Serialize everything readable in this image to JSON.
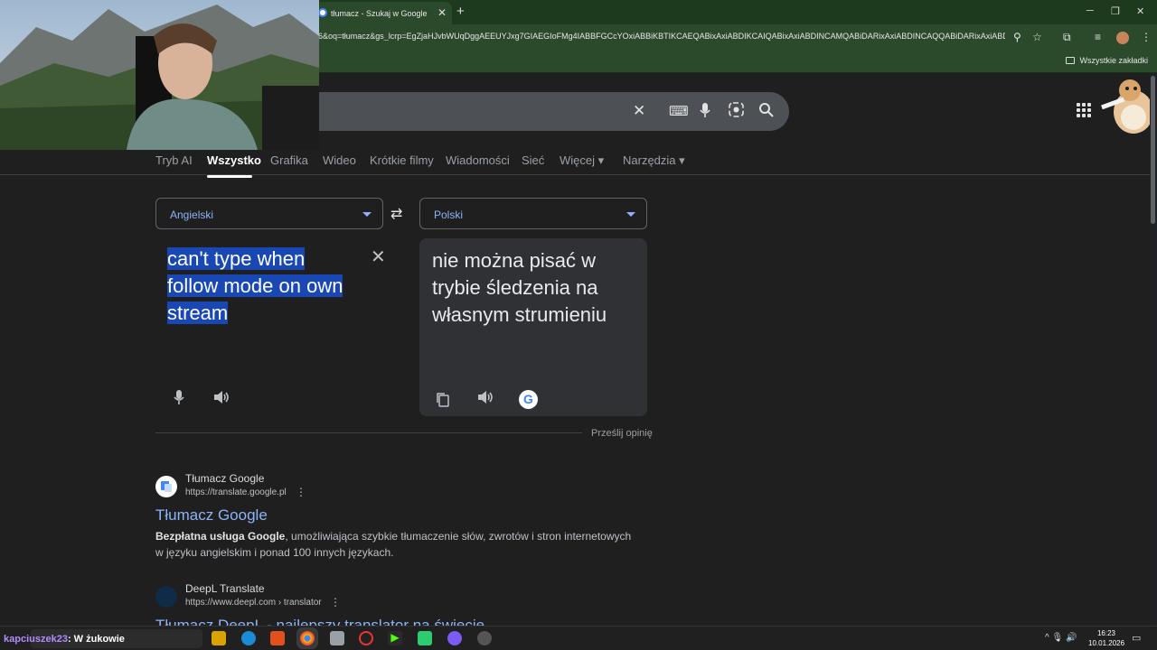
{
  "browser": {
    "tab_title": "tłumacz - Szukaj w Google",
    "tab_close": "✕",
    "new_tab": "+",
    "url": "6&oq=tłumacz&gs_lcrp=EgZjaHJvbWUqDggAEEUYJxg7GIAEGIoFMg4IABBFGCcYOxiABBiKBTIKCAEQABixAxiABDIKCAIQABixAxiABDINCAMQABiDARixAxiABDINCAQQABiDARixAxiABDI...",
    "bookmarks_all": "Wszystkie zakładki",
    "window_controls": {
      "minimize": "─",
      "restore": "❐",
      "close": "✕"
    }
  },
  "search": {
    "clear": "✕",
    "keyboard_icon": "⌨",
    "mic_icon": "🎤",
    "lens_icon": "⊙",
    "search_icon": "⚲"
  },
  "tabs": [
    {
      "label": "Tryb AI"
    },
    {
      "label": "Wszystko"
    },
    {
      "label": "Grafika"
    },
    {
      "label": "Wideo"
    },
    {
      "label": "Krótkie filmy"
    },
    {
      "label": "Wiadomości"
    },
    {
      "label": "Sieć"
    },
    {
      "label": "Więcej ▾"
    },
    {
      "label": "Narzędzia ▾"
    }
  ],
  "translate": {
    "source_lang": "Angielski",
    "target_lang": "Polski",
    "swap": "⇄",
    "source_line1": "can't type when",
    "source_line2": "follow mode on own",
    "source_line3": "stream",
    "target_text": "nie można pisać w trybie śledzenia na własnym strumieniu",
    "clear": "✕",
    "feedback": "Prześlij opinię",
    "google_letter": "G"
  },
  "results": [
    {
      "site": "Tłumacz Google",
      "url": "https://translate.google.pl",
      "title": "Tłumacz Google",
      "snippet_bold": "Bezpłatna usługa Google",
      "snippet_rest": ", umożliwiająca szybkie tłumaczenie słów, zwrotów i stron internetowych w języku angielskim i ponad 100 innych językach."
    },
    {
      "site": "DeepL Translate",
      "url": "https://www.deepl.com › translator",
      "title": "Tłumacz DeepL - najlepszy translator na świecie"
    }
  ],
  "taskbar": {
    "chat_user": "kapciuszek23",
    "chat_sep": ":",
    "chat_msg": " W żukowie",
    "tray": "^  🎙  🔊",
    "time": "16:23",
    "date": "10.01.2026",
    "notif": "▭"
  },
  "colors": {
    "tab_bar": "#1e3a1e",
    "toolbar": "#2b4a2b",
    "accent_link": "#8ab4f8",
    "selection": "#1947b3",
    "page_bg": "#1f1f1f"
  }
}
